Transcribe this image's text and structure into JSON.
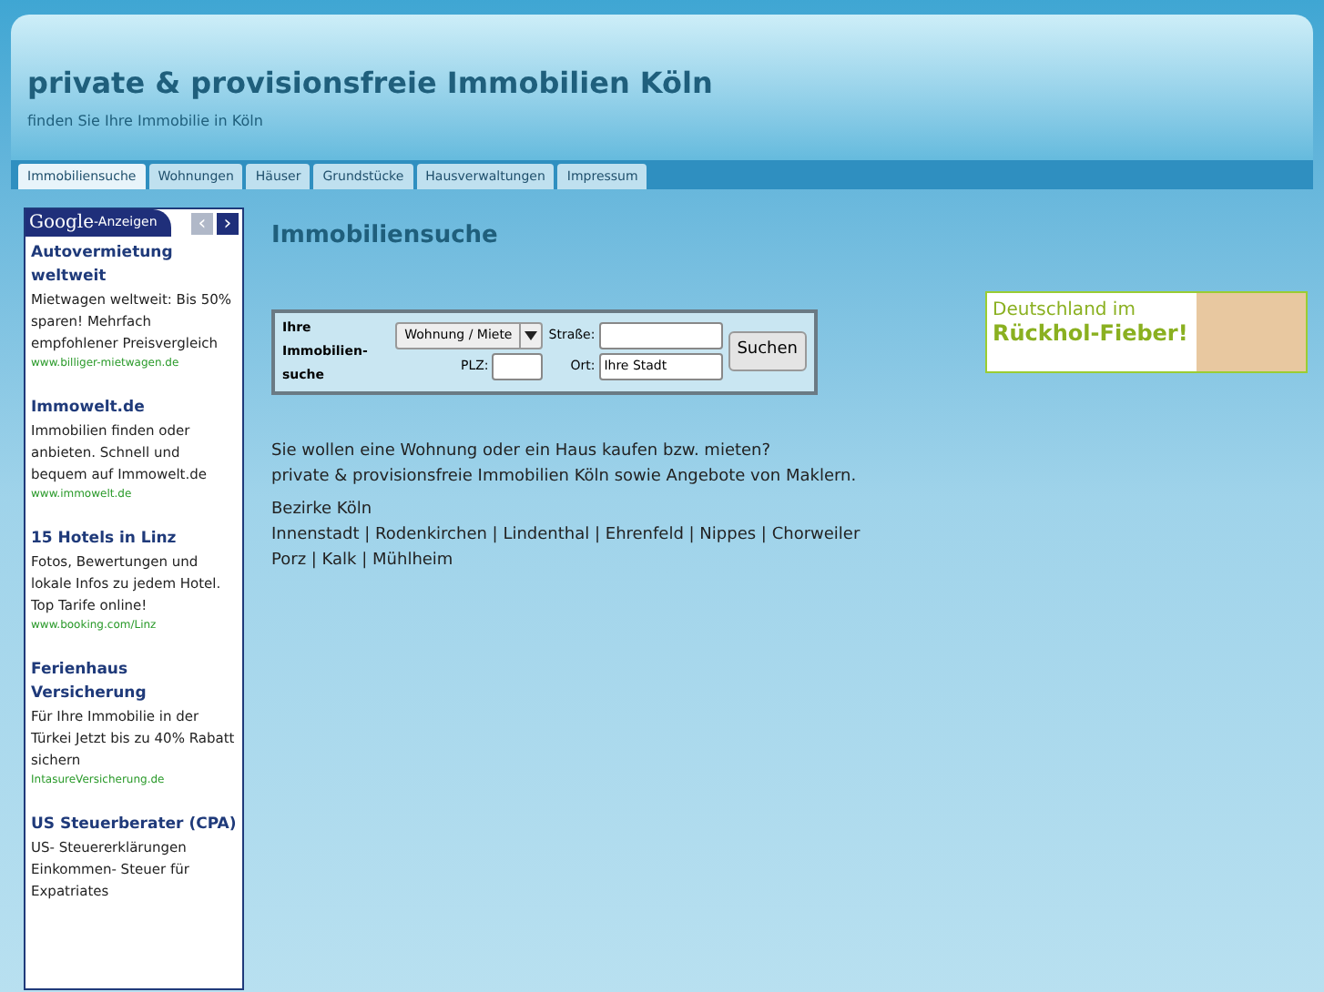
{
  "header": {
    "title": "private & provisionsfreie Immobilien Köln",
    "subtitle": "finden Sie Ihre Immobilie in Köln"
  },
  "tabs": [
    {
      "label": "Immobiliensuche",
      "selected": true
    },
    {
      "label": "Wohnungen",
      "selected": false
    },
    {
      "label": "Häuser",
      "selected": false
    },
    {
      "label": "Grundstücke",
      "selected": false
    },
    {
      "label": "Hausverwaltungen",
      "selected": false
    },
    {
      "label": "Impressum",
      "selected": false
    }
  ],
  "ads": {
    "brand": "Google",
    "label": "-Anzeigen",
    "prev": "‹",
    "next": "›",
    "items": [
      {
        "title": "Autovermietung weltweit",
        "text": "Mietwagen weltweit: Bis 50% sparen! Mehrfach empfohlener Preisvergleich",
        "url": "www.billiger-mietwagen.de"
      },
      {
        "title": "Immowelt.de",
        "text": "Immobilien finden oder anbieten. Schnell und bequem auf Immowelt.de",
        "url": "www.immowelt.de"
      },
      {
        "title": "15 Hotels in Linz",
        "text": "Fotos, Bewertungen und lokale Infos zu jedem Hotel. Top Tarife online!",
        "url": "www.booking.com/Linz"
      },
      {
        "title": "Ferienhaus Versicherung",
        "text": "Für Ihre Immobilie in der Türkei Jetzt bis zu 40% Rabatt sichern",
        "url": "IntasureVersicherung.de"
      },
      {
        "title": "US Steuerberater (CPA)",
        "text": "US- Steuererklärungen Einkommen- Steuer für Expatriates"
      }
    ]
  },
  "main": {
    "heading": "Immobiliensuche",
    "search": {
      "label": "Ihre Immobilien-suche",
      "type_select": "Wohnung / Miete",
      "street_label": "Straße:",
      "zip_label": "PLZ:",
      "city_label": "Ort:",
      "city_value": "Ihre Stadt",
      "button": "Suchen"
    },
    "intro": [
      "Sie wollen eine Wohnung oder ein Haus kaufen bzw. mieten?",
      "private & provisionsfreie Immobilien Köln sowie Angebote von Maklern."
    ],
    "districts_heading": "Bezirke Köln",
    "districts": [
      "Innenstadt | Rodenkirchen | Lindenthal | Ehrenfeld | Nippes | Chorweiler",
      "Porz | Kalk | Mühlheim"
    ]
  },
  "banner": {
    "line_1": "Deutschland im",
    "line_2": "Rückhol-Fieber!"
  }
}
